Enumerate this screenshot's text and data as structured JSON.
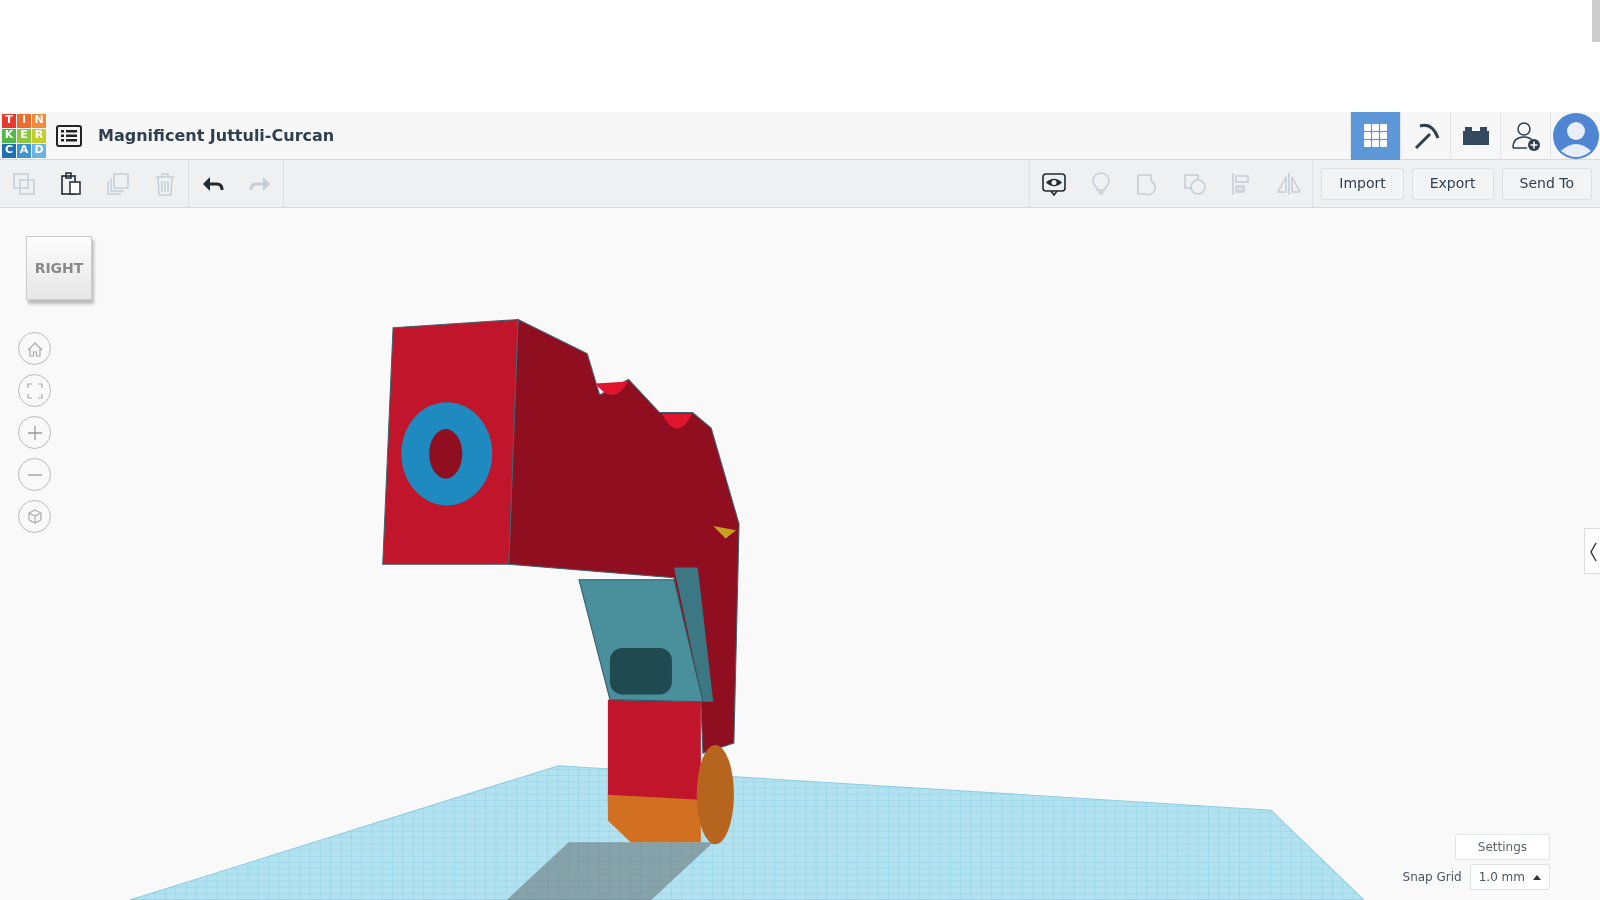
{
  "header": {
    "logo_letters": [
      "T",
      "I",
      "N",
      "K",
      "E",
      "R",
      "C",
      "A",
      "D"
    ],
    "title": "Magnificent Juttuli-Curcan",
    "nav": [
      {
        "kind": "grid",
        "selected": true
      },
      {
        "kind": "pickaxe",
        "selected": false
      },
      {
        "kind": "brick",
        "selected": false
      },
      {
        "kind": "user-add",
        "selected": false
      },
      {
        "kind": "avatar",
        "selected": false
      }
    ]
  },
  "toolbar": {
    "edit_tools": [
      {
        "kind": "copy",
        "disabled": true
      },
      {
        "kind": "paste",
        "disabled": false
      },
      {
        "kind": "duplicate",
        "disabled": true
      },
      {
        "kind": "delete",
        "disabled": true
      }
    ],
    "history_tools": [
      {
        "kind": "undo",
        "disabled": false
      },
      {
        "kind": "redo",
        "disabled": true
      }
    ],
    "shape_tools": [
      {
        "kind": "notes",
        "disabled": false
      },
      {
        "kind": "light",
        "disabled": true
      },
      {
        "kind": "group",
        "disabled": true
      },
      {
        "kind": "ungroup",
        "disabled": true
      },
      {
        "kind": "align",
        "disabled": true
      },
      {
        "kind": "mirror",
        "disabled": true
      }
    ],
    "buttons": [
      "Import",
      "Export",
      "Send To"
    ]
  },
  "viewport": {
    "view_cube": "RIGHT",
    "view_controls": [
      {
        "kind": "home"
      },
      {
        "kind": "fit"
      },
      {
        "kind": "zoom-in"
      },
      {
        "kind": "zoom-out"
      },
      {
        "kind": "perspective"
      }
    ],
    "settings": "Settings",
    "snap_grid": {
      "label": "Snap Grid",
      "value": "1.0 mm"
    }
  }
}
